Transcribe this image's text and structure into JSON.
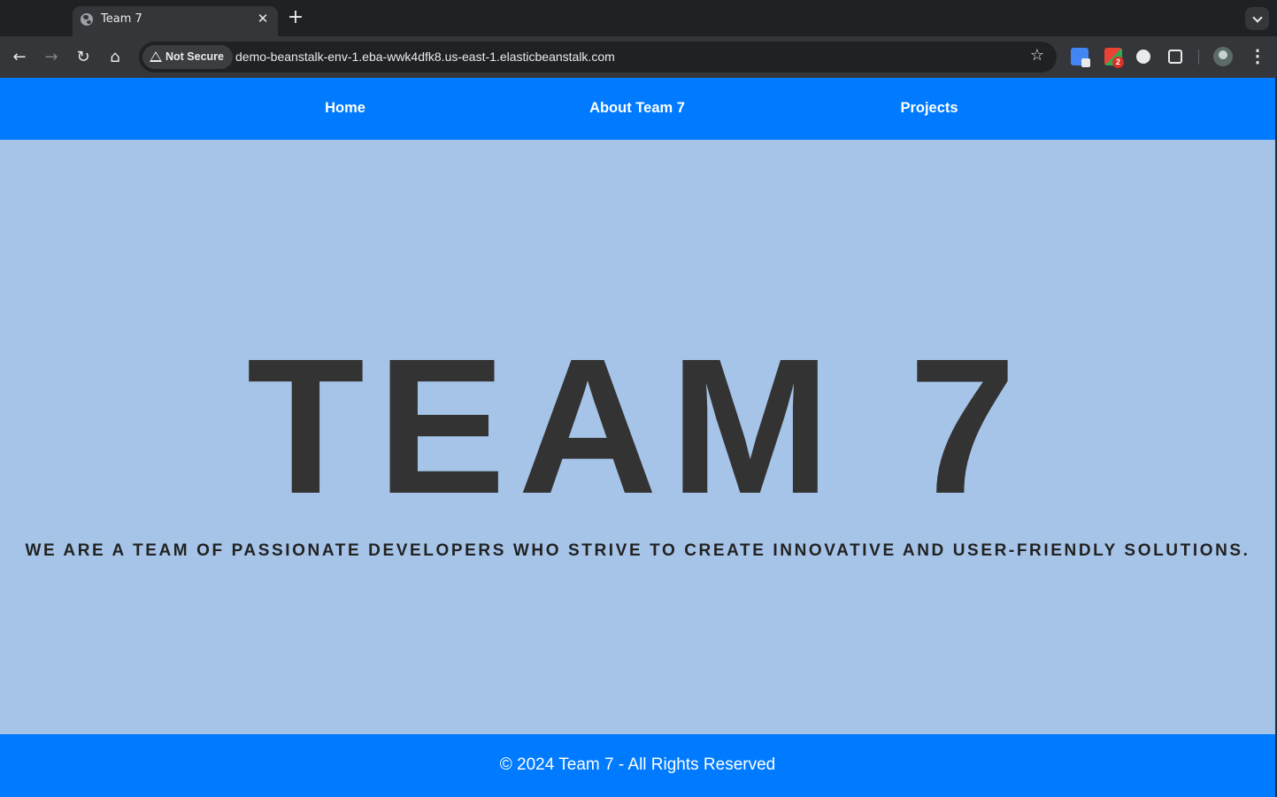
{
  "browser": {
    "tab": {
      "title": "Team 7"
    },
    "security_label": "Not Secure",
    "url": "demo-beanstalk-env-1.eba-wwk4dfk8.us-east-1.elasticbeanstalk.com",
    "extension_badge": "2",
    "icons": {
      "back": "←",
      "forward": "→",
      "reload": "↻",
      "home": "⌂",
      "star": "☆",
      "close": "✕",
      "new_tab": "+",
      "menu": "⋮"
    }
  },
  "site": {
    "nav": {
      "home": "Home",
      "about": "About Team 7",
      "projects": "Projects"
    },
    "hero": {
      "title": "TEAM 7",
      "subtitle": "WE ARE A TEAM OF PASSIONATE DEVELOPERS WHO STRIVE TO CREATE INNOVATIVE AND USER-FRIENDLY SOLUTIONS."
    },
    "footer": "© 2024 Team 7 - All Rights Reserved"
  },
  "colors": {
    "nav_bg": "#007bff",
    "page_bg": "#a6c4e8",
    "text_dark": "#333333"
  }
}
